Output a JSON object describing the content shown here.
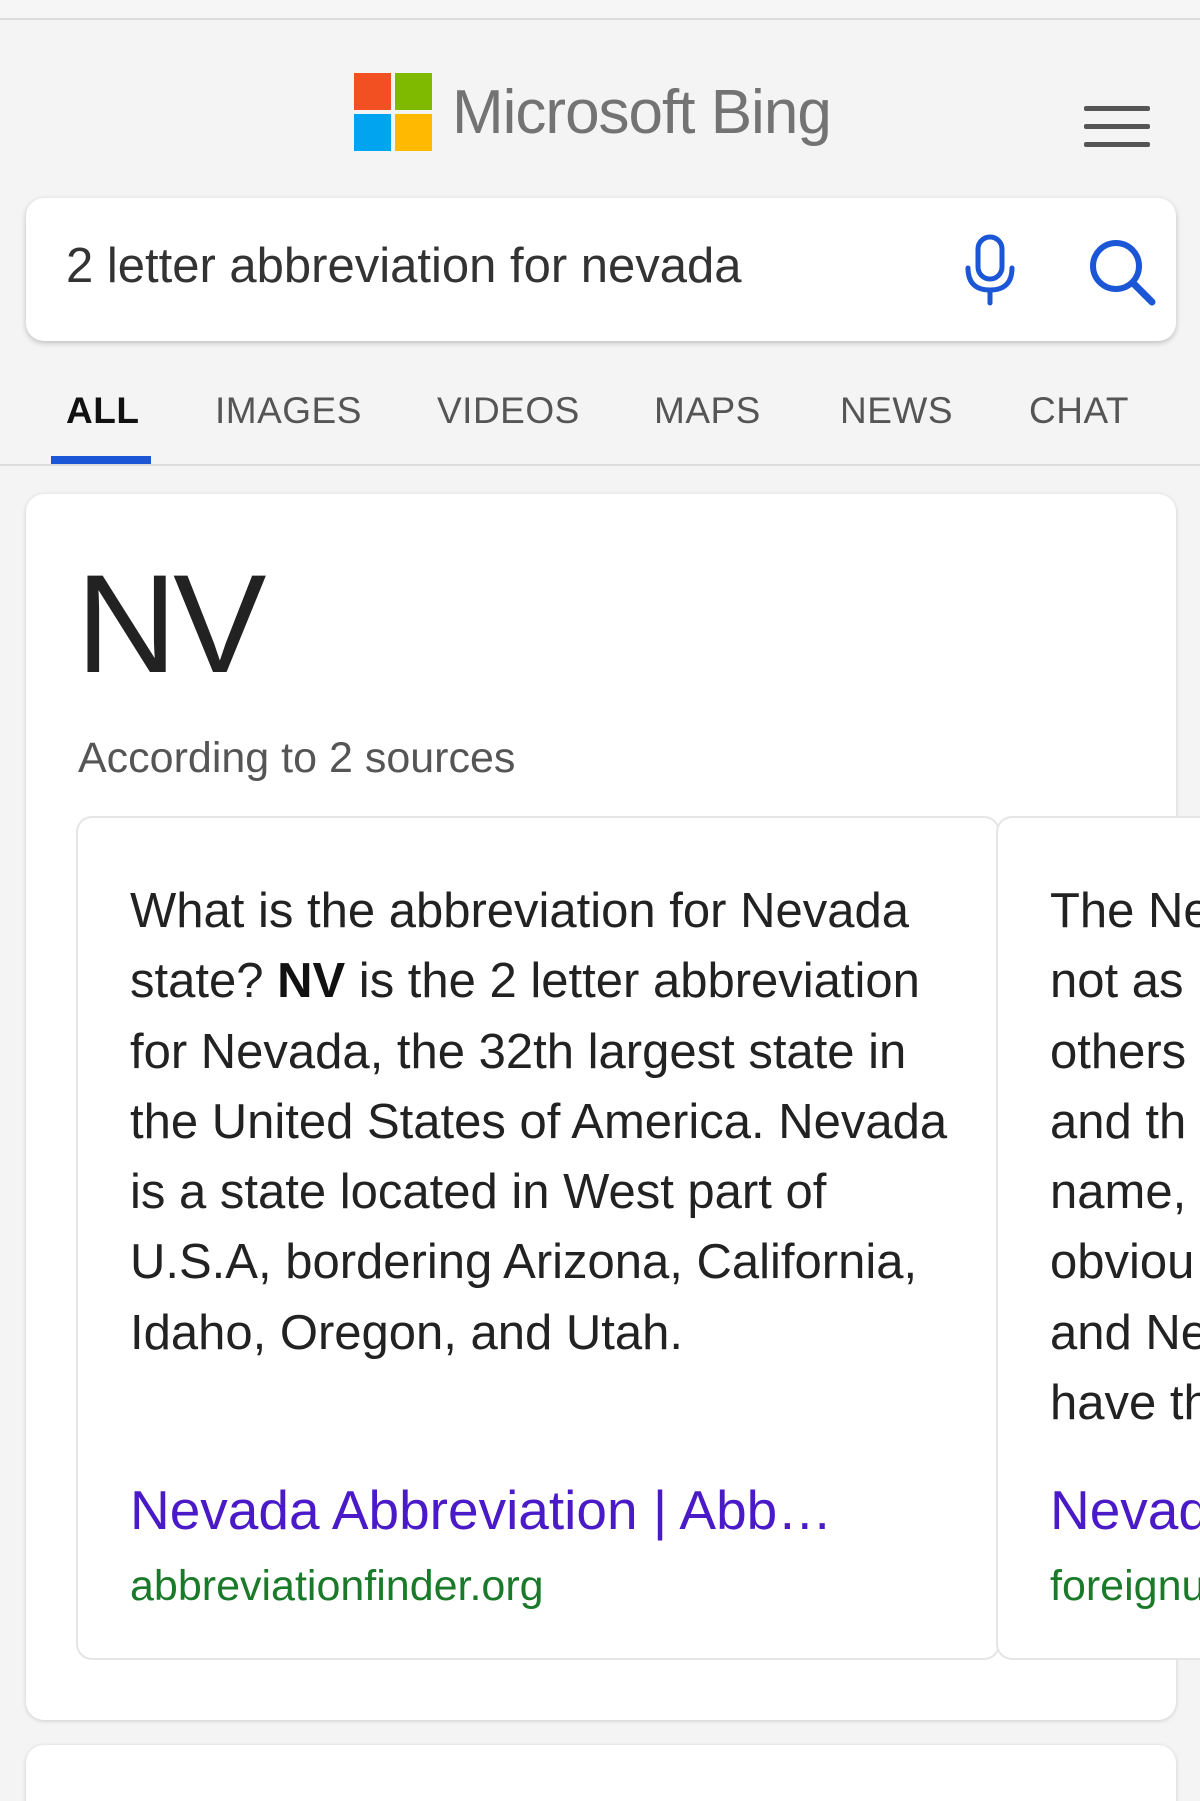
{
  "header": {
    "brand": "Microsoft Bing",
    "brand_colors": [
      "#f25022",
      "#7fba00",
      "#00a4ef",
      "#ffb900"
    ],
    "menu_icon": "hamburger-menu-icon"
  },
  "search": {
    "query": "2 letter abbreviation for nevada",
    "mic_icon": "microphone-icon",
    "search_icon": "search-icon",
    "accent_color": "#1a56d6"
  },
  "tabs": [
    {
      "label": "ALL",
      "active": true
    },
    {
      "label": "IMAGES",
      "active": false
    },
    {
      "label": "VIDEOS",
      "active": false
    },
    {
      "label": "MAPS",
      "active": false
    },
    {
      "label": "NEWS",
      "active": false
    },
    {
      "label": "CHAT",
      "active": false
    }
  ],
  "answer": {
    "title": "NV",
    "source_count": "According to 2 sources",
    "sources": [
      {
        "snippet_before": "What is the abbreviation for Nevada state? ",
        "snippet_bold": "NV",
        "snippet_after": " is the 2 letter abbreviation for Nevada, the 32th largest state in the United States of America. Nevada is a state located in West part of U.S.A, bordering Arizona, California, Idaho, Oregon, and Utah.",
        "link_title": "Nevada Abbreviation | Abb…",
        "domain": "abbreviationfinder.org"
      },
      {
        "snippet_lines": [
          "The Ne",
          "not as",
          "others",
          "and th",
          "name,",
          "obviou",
          "and Ne",
          "have th"
        ],
        "link_title": "Nevad",
        "domain": "foreignu"
      }
    ]
  }
}
